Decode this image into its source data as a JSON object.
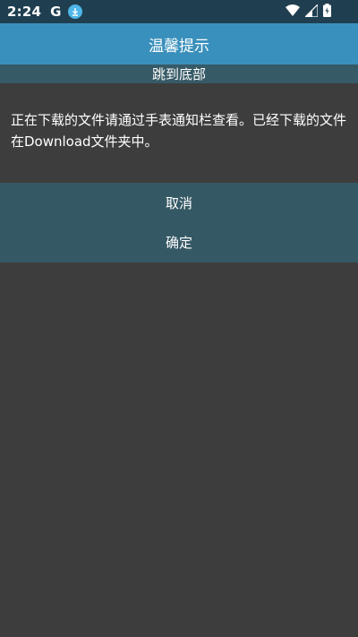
{
  "status_bar": {
    "time": "2:24",
    "app_letter": "G"
  },
  "dialog": {
    "title": "温馨提示",
    "jump_to_bottom": "跳到底部",
    "message": "正在下载的文件请通过手表通知栏查看。已经下载的文件在Download文件夹中。",
    "cancel_label": "取消",
    "confirm_label": "确定"
  },
  "colors": {
    "status_bar": "#1f3f50",
    "title_bar": "#3a90bc",
    "jump_bar": "#365a66",
    "background": "#3d3d3d",
    "button_area": "#355865",
    "download_badge": "#4fb7ea"
  }
}
